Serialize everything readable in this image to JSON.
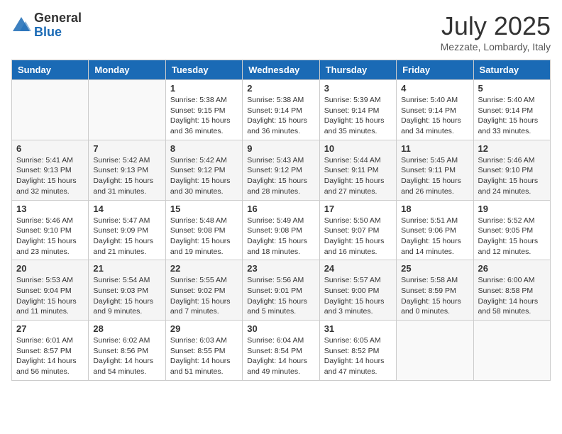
{
  "logo": {
    "general": "General",
    "blue": "Blue"
  },
  "title": "July 2025",
  "location": "Mezzate, Lombardy, Italy",
  "weekdays": [
    "Sunday",
    "Monday",
    "Tuesday",
    "Wednesday",
    "Thursday",
    "Friday",
    "Saturday"
  ],
  "rows": [
    [
      {
        "day": "",
        "sunrise": "",
        "sunset": "",
        "daylight": ""
      },
      {
        "day": "",
        "sunrise": "",
        "sunset": "",
        "daylight": ""
      },
      {
        "day": "1",
        "sunrise": "Sunrise: 5:38 AM",
        "sunset": "Sunset: 9:15 PM",
        "daylight": "Daylight: 15 hours and 36 minutes."
      },
      {
        "day": "2",
        "sunrise": "Sunrise: 5:38 AM",
        "sunset": "Sunset: 9:14 PM",
        "daylight": "Daylight: 15 hours and 36 minutes."
      },
      {
        "day": "3",
        "sunrise": "Sunrise: 5:39 AM",
        "sunset": "Sunset: 9:14 PM",
        "daylight": "Daylight: 15 hours and 35 minutes."
      },
      {
        "day": "4",
        "sunrise": "Sunrise: 5:40 AM",
        "sunset": "Sunset: 9:14 PM",
        "daylight": "Daylight: 15 hours and 34 minutes."
      },
      {
        "day": "5",
        "sunrise": "Sunrise: 5:40 AM",
        "sunset": "Sunset: 9:14 PM",
        "daylight": "Daylight: 15 hours and 33 minutes."
      }
    ],
    [
      {
        "day": "6",
        "sunrise": "Sunrise: 5:41 AM",
        "sunset": "Sunset: 9:13 PM",
        "daylight": "Daylight: 15 hours and 32 minutes."
      },
      {
        "day": "7",
        "sunrise": "Sunrise: 5:42 AM",
        "sunset": "Sunset: 9:13 PM",
        "daylight": "Daylight: 15 hours and 31 minutes."
      },
      {
        "day": "8",
        "sunrise": "Sunrise: 5:42 AM",
        "sunset": "Sunset: 9:12 PM",
        "daylight": "Daylight: 15 hours and 30 minutes."
      },
      {
        "day": "9",
        "sunrise": "Sunrise: 5:43 AM",
        "sunset": "Sunset: 9:12 PM",
        "daylight": "Daylight: 15 hours and 28 minutes."
      },
      {
        "day": "10",
        "sunrise": "Sunrise: 5:44 AM",
        "sunset": "Sunset: 9:11 PM",
        "daylight": "Daylight: 15 hours and 27 minutes."
      },
      {
        "day": "11",
        "sunrise": "Sunrise: 5:45 AM",
        "sunset": "Sunset: 9:11 PM",
        "daylight": "Daylight: 15 hours and 26 minutes."
      },
      {
        "day": "12",
        "sunrise": "Sunrise: 5:46 AM",
        "sunset": "Sunset: 9:10 PM",
        "daylight": "Daylight: 15 hours and 24 minutes."
      }
    ],
    [
      {
        "day": "13",
        "sunrise": "Sunrise: 5:46 AM",
        "sunset": "Sunset: 9:10 PM",
        "daylight": "Daylight: 15 hours and 23 minutes."
      },
      {
        "day": "14",
        "sunrise": "Sunrise: 5:47 AM",
        "sunset": "Sunset: 9:09 PM",
        "daylight": "Daylight: 15 hours and 21 minutes."
      },
      {
        "day": "15",
        "sunrise": "Sunrise: 5:48 AM",
        "sunset": "Sunset: 9:08 PM",
        "daylight": "Daylight: 15 hours and 19 minutes."
      },
      {
        "day": "16",
        "sunrise": "Sunrise: 5:49 AM",
        "sunset": "Sunset: 9:08 PM",
        "daylight": "Daylight: 15 hours and 18 minutes."
      },
      {
        "day": "17",
        "sunrise": "Sunrise: 5:50 AM",
        "sunset": "Sunset: 9:07 PM",
        "daylight": "Daylight: 15 hours and 16 minutes."
      },
      {
        "day": "18",
        "sunrise": "Sunrise: 5:51 AM",
        "sunset": "Sunset: 9:06 PM",
        "daylight": "Daylight: 15 hours and 14 minutes."
      },
      {
        "day": "19",
        "sunrise": "Sunrise: 5:52 AM",
        "sunset": "Sunset: 9:05 PM",
        "daylight": "Daylight: 15 hours and 12 minutes."
      }
    ],
    [
      {
        "day": "20",
        "sunrise": "Sunrise: 5:53 AM",
        "sunset": "Sunset: 9:04 PM",
        "daylight": "Daylight: 15 hours and 11 minutes."
      },
      {
        "day": "21",
        "sunrise": "Sunrise: 5:54 AM",
        "sunset": "Sunset: 9:03 PM",
        "daylight": "Daylight: 15 hours and 9 minutes."
      },
      {
        "day": "22",
        "sunrise": "Sunrise: 5:55 AM",
        "sunset": "Sunset: 9:02 PM",
        "daylight": "Daylight: 15 hours and 7 minutes."
      },
      {
        "day": "23",
        "sunrise": "Sunrise: 5:56 AM",
        "sunset": "Sunset: 9:01 PM",
        "daylight": "Daylight: 15 hours and 5 minutes."
      },
      {
        "day": "24",
        "sunrise": "Sunrise: 5:57 AM",
        "sunset": "Sunset: 9:00 PM",
        "daylight": "Daylight: 15 hours and 3 minutes."
      },
      {
        "day": "25",
        "sunrise": "Sunrise: 5:58 AM",
        "sunset": "Sunset: 8:59 PM",
        "daylight": "Daylight: 15 hours and 0 minutes."
      },
      {
        "day": "26",
        "sunrise": "Sunrise: 6:00 AM",
        "sunset": "Sunset: 8:58 PM",
        "daylight": "Daylight: 14 hours and 58 minutes."
      }
    ],
    [
      {
        "day": "27",
        "sunrise": "Sunrise: 6:01 AM",
        "sunset": "Sunset: 8:57 PM",
        "daylight": "Daylight: 14 hours and 56 minutes."
      },
      {
        "day": "28",
        "sunrise": "Sunrise: 6:02 AM",
        "sunset": "Sunset: 8:56 PM",
        "daylight": "Daylight: 14 hours and 54 minutes."
      },
      {
        "day": "29",
        "sunrise": "Sunrise: 6:03 AM",
        "sunset": "Sunset: 8:55 PM",
        "daylight": "Daylight: 14 hours and 51 minutes."
      },
      {
        "day": "30",
        "sunrise": "Sunrise: 6:04 AM",
        "sunset": "Sunset: 8:54 PM",
        "daylight": "Daylight: 14 hours and 49 minutes."
      },
      {
        "day": "31",
        "sunrise": "Sunrise: 6:05 AM",
        "sunset": "Sunset: 8:52 PM",
        "daylight": "Daylight: 14 hours and 47 minutes."
      },
      {
        "day": "",
        "sunrise": "",
        "sunset": "",
        "daylight": ""
      },
      {
        "day": "",
        "sunrise": "",
        "sunset": "",
        "daylight": ""
      }
    ]
  ]
}
